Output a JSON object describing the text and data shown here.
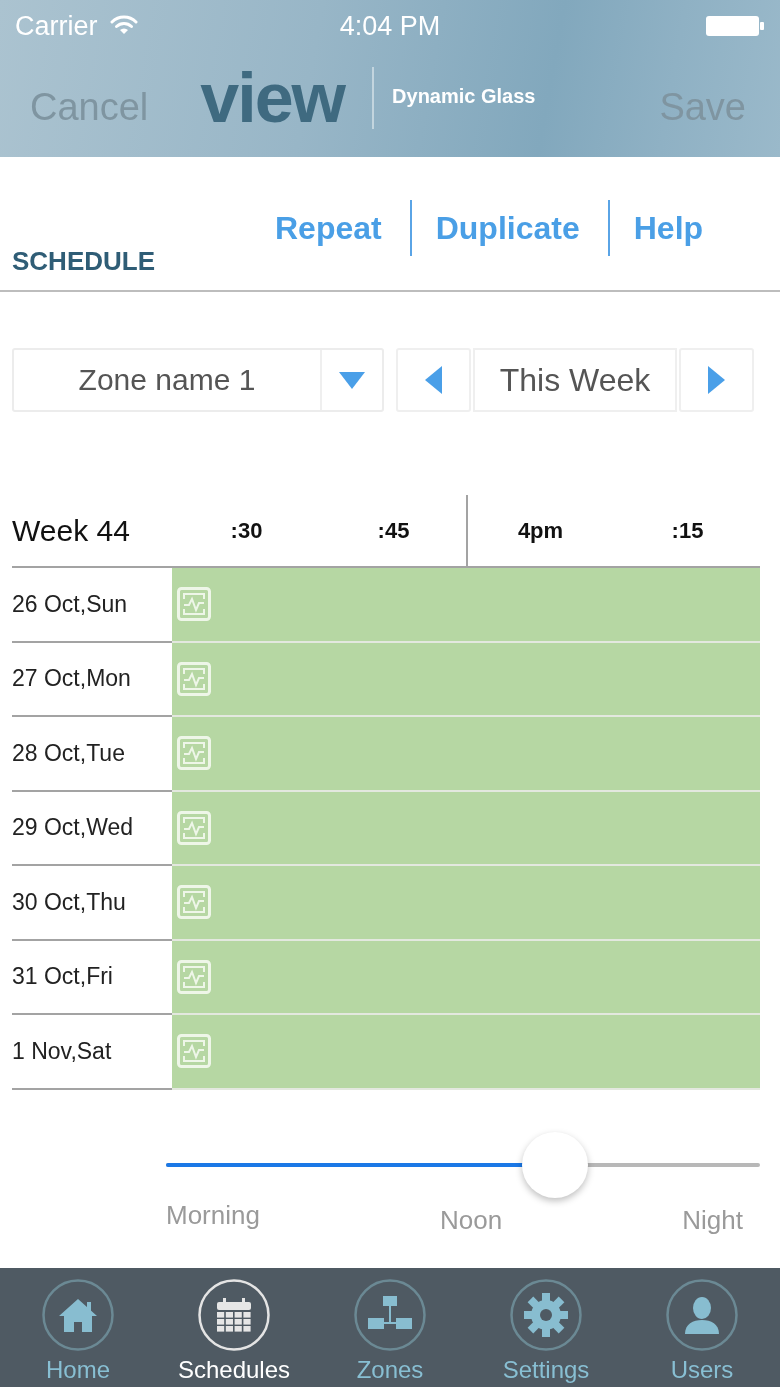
{
  "status_bar": {
    "carrier": "Carrier",
    "time": "4:04 PM"
  },
  "nav_bar": {
    "cancel": {
      "label": "Cancel",
      "disabled": true
    },
    "logo": "view",
    "tagline": "Dynamic Glass",
    "save": {
      "label": "Save",
      "disabled": true
    }
  },
  "toolbar": {
    "title": "SCHEDULE",
    "links": [
      "Repeat",
      "Duplicate",
      "Help"
    ]
  },
  "zone_select": {
    "value": "Zone name 1"
  },
  "week_nav": {
    "label": "This Week"
  },
  "schedule": {
    "week": "Week 44",
    "ticks": [
      {
        "label": ":30",
        "hour": false
      },
      {
        "label": ":45",
        "hour": false
      },
      {
        "label": "4pm",
        "hour": true
      },
      {
        "label": ":15",
        "hour": false
      }
    ],
    "rows": [
      {
        "day": "26 Oct,Sun"
      },
      {
        "day": "27 Oct,Mon"
      },
      {
        "day": "28 Oct,Tue"
      },
      {
        "day": "29 Oct,Wed"
      },
      {
        "day": "30 Oct,Thu"
      },
      {
        "day": "31 Oct,Fri"
      },
      {
        "day": "1 Nov,Sat"
      }
    ]
  },
  "slider": {
    "level": 0.655,
    "labels": [
      "Morning",
      "Noon",
      "Night"
    ]
  },
  "tabs": [
    {
      "label": "Home",
      "selected": false
    },
    {
      "label": "Schedules",
      "selected": true
    },
    {
      "label": "Zones",
      "selected": false
    },
    {
      "label": "Settings",
      "selected": false
    },
    {
      "label": "Users",
      "selected": false
    }
  ]
}
